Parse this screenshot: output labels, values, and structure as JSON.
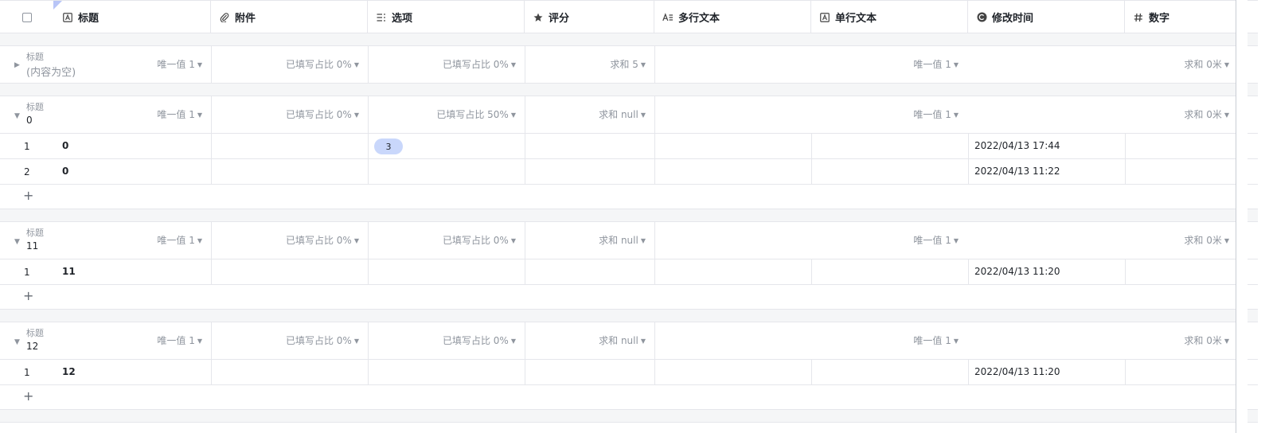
{
  "columns": [
    {
      "label": "标题",
      "icon": "text-field-icon"
    },
    {
      "label": "附件",
      "icon": "attachment-icon"
    },
    {
      "label": "选项",
      "icon": "options-icon"
    },
    {
      "label": "评分",
      "icon": "star-icon"
    },
    {
      "label": "多行文本",
      "icon": "multiline-text-icon"
    },
    {
      "label": "单行文本",
      "icon": "text-field-icon"
    },
    {
      "label": "修改时间",
      "icon": "clock-icon"
    },
    {
      "label": "数字",
      "icon": "hash-icon"
    }
  ],
  "group_label": "标题",
  "groups": [
    {
      "value": "(内容为空)",
      "collapsed": true,
      "stats": {
        "title": "唯一值 1",
        "attach": "已填写占比 0%",
        "options": "已填写占比 0%",
        "rating": "求和 5",
        "single": "唯一值 1",
        "number": "求和 0米"
      },
      "rows": []
    },
    {
      "value": "0",
      "collapsed": false,
      "stats": {
        "title": "唯一值 1",
        "attach": "已填写占比 0%",
        "options": "已填写占比 50%",
        "rating": "求和 null",
        "single": "唯一值 1",
        "number": "求和 0米"
      },
      "rows": [
        {
          "num": "1",
          "title": "0",
          "tag": "3",
          "time": "2022/04/13 17:44"
        },
        {
          "num": "2",
          "title": "0",
          "tag": "",
          "time": "2022/04/13 11:22"
        }
      ]
    },
    {
      "value": "11",
      "collapsed": false,
      "stats": {
        "title": "唯一值 1",
        "attach": "已填写占比 0%",
        "options": "已填写占比 0%",
        "rating": "求和 null",
        "single": "唯一值 1",
        "number": "求和 0米"
      },
      "rows": [
        {
          "num": "1",
          "title": "11",
          "tag": "",
          "time": "2022/04/13 11:20"
        }
      ]
    },
    {
      "value": "12",
      "collapsed": false,
      "stats": {
        "title": "唯一值 1",
        "attach": "已填写占比 0%",
        "options": "已填写占比 0%",
        "rating": "求和 null",
        "single": "唯一值 1",
        "number": "求和 0米"
      },
      "rows": [
        {
          "num": "1",
          "title": "12",
          "tag": "",
          "time": "2022/04/13 11:20"
        }
      ]
    }
  ],
  "add_symbol": "+"
}
